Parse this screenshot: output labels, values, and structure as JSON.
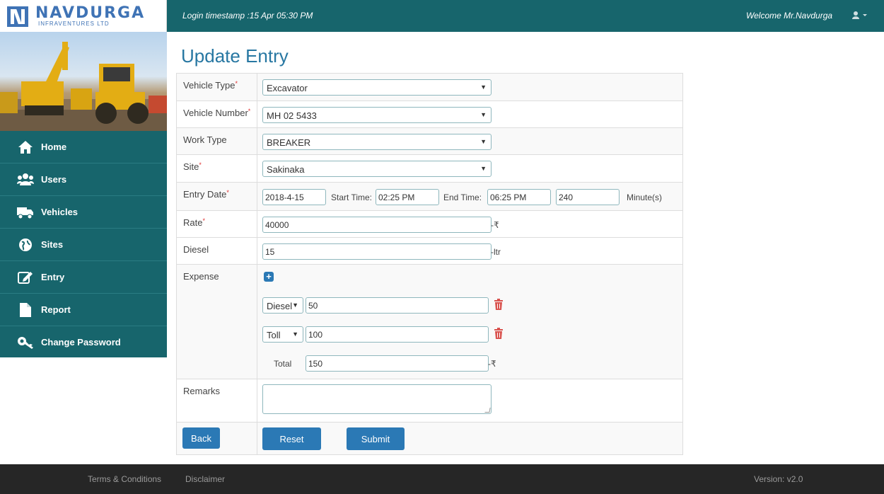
{
  "header": {
    "logo_name": "NAVDURGA",
    "logo_sub": "INFRAVENTURES LTD",
    "login_timestamp": "Login timestamp :15 Apr 05:30 PM",
    "welcome": "Welcome Mr.Navdurga"
  },
  "sidebar": {
    "items": [
      {
        "label": "Home",
        "icon": "home-icon"
      },
      {
        "label": "Users",
        "icon": "users-icon"
      },
      {
        "label": "Vehicles",
        "icon": "truck-icon"
      },
      {
        "label": "Sites",
        "icon": "globe-icon"
      },
      {
        "label": "Entry",
        "icon": "edit-icon"
      },
      {
        "label": "Report",
        "icon": "file-icon"
      },
      {
        "label": "Change Password",
        "icon": "key-icon"
      }
    ]
  },
  "page": {
    "title": "Update Entry"
  },
  "form": {
    "vehicle_type": {
      "label": "Vehicle Type",
      "value": "Excavator"
    },
    "vehicle_number": {
      "label": "Vehicle Number",
      "value": "MH 02 5433"
    },
    "work_type": {
      "label": "Work Type",
      "value": "BREAKER"
    },
    "site": {
      "label": "Site",
      "value": "Sakinaka"
    },
    "entry_date": {
      "label": "Entry Date",
      "date": "2018-4-15",
      "start_label": "Start Time:",
      "start_time": "02:25 PM",
      "end_label": "End Time:",
      "end_time": "06:25 PM",
      "minutes": "240",
      "minutes_unit": "Minute(s)"
    },
    "rate": {
      "label": "Rate",
      "value": "40000",
      "unit": "-₹"
    },
    "diesel": {
      "label": "Diesel",
      "value": "15",
      "unit": "-ltr"
    },
    "expense": {
      "label": "Expense",
      "rows": [
        {
          "type": "Diesel",
          "amount": "50"
        },
        {
          "type": "Toll",
          "amount": "100"
        }
      ],
      "total_label": "Total",
      "total": "150",
      "total_unit": "-₹"
    },
    "remarks": {
      "label": "Remarks",
      "value": ""
    },
    "required_mark": "*",
    "buttons": {
      "back": "Back",
      "reset": "Reset",
      "submit": "Submit"
    }
  },
  "footer": {
    "terms": "Terms & Conditions",
    "disclaimer": "Disclaimer",
    "version": "Version: v2.0"
  }
}
